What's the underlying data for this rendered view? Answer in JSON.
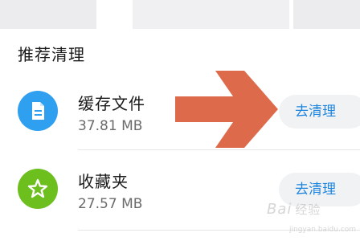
{
  "section": {
    "title": "推荐清理"
  },
  "items": [
    {
      "name": "缓存文件",
      "size": "37.81 MB",
      "button_label": "去清理",
      "icon": "file-icon",
      "icon_color": "#2f9ff0"
    },
    {
      "name": "收藏夹",
      "size": "27.57 MB",
      "button_label": "去清理",
      "icon": "star-icon",
      "icon_color": "#6cbf1c"
    }
  ],
  "overlay": {
    "arrow_color": "#dd6a4a"
  },
  "watermark": {
    "brand": "Bai",
    "sub": "经验",
    "url": "jingyan.baidu.com"
  }
}
